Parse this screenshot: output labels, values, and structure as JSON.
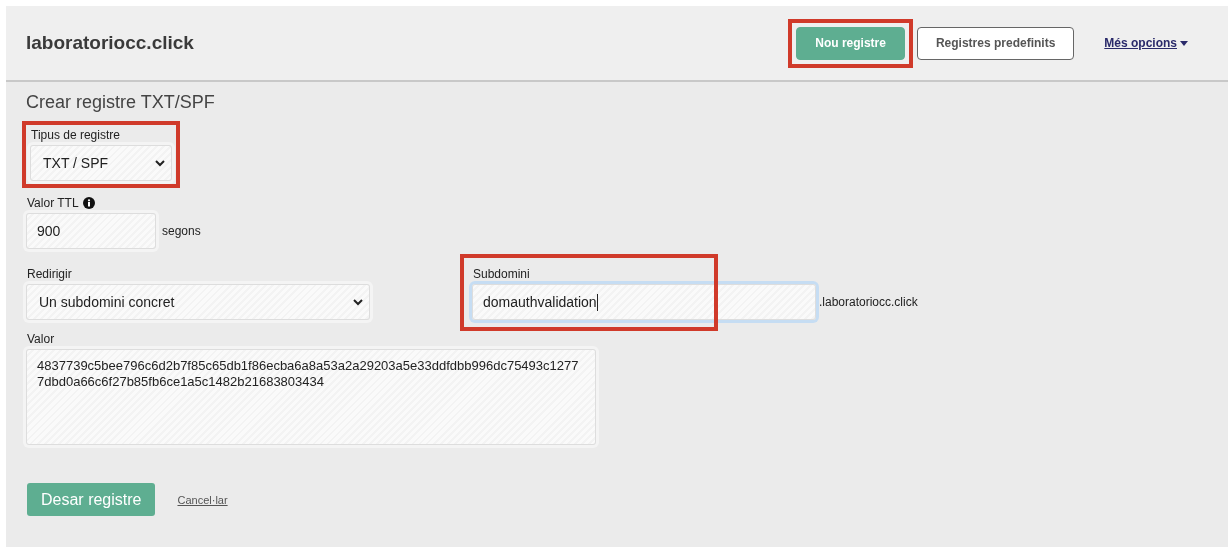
{
  "header": {
    "site": "laboratoriocc.click",
    "buttons": [
      {
        "label": "Nou registre",
        "kind": "primary",
        "highlighted": true
      },
      {
        "label": "Registres predefinits",
        "kind": "outline",
        "highlighted": false
      }
    ],
    "menu": {
      "label": "Més opcions"
    }
  },
  "form": {
    "title": "Crear registre TXT/SPF",
    "record_type": {
      "label": "Tipus de registre",
      "value": "TXT / SPF",
      "highlighted": true
    },
    "ttl": {
      "label": "Valor TTL",
      "value": "900",
      "unit": "segons"
    },
    "redirect": {
      "label": "Redirigir",
      "value": "Un subdomini concret"
    },
    "subdomain": {
      "label": "Subdomini",
      "value": "domauthvalidation",
      "suffix": ".laboratoriocc.click",
      "highlighted": true,
      "focused": true
    },
    "value": {
      "label": "Valor",
      "value": "4837739c5bee796c6d2b7f85c65db1f86ecba6a8a53a2a29203a5e33ddfdbb996dc75493c12777dbd0a66c6f27b85fb6ce1a5c1482b21683803434"
    },
    "submit": "Desar registre",
    "cancel": "Cancel·lar"
  }
}
